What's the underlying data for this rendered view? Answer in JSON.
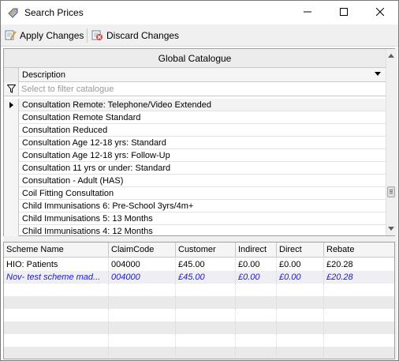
{
  "window": {
    "title": "Search Prices",
    "icons": {
      "app": "price-tag-icon",
      "minimize": "minimize-icon",
      "maximize": "maximize-icon",
      "close": "close-icon"
    }
  },
  "toolbar": {
    "apply_label": "Apply Changes",
    "apply_icon": "apply-changes-icon",
    "discard_label": "Discard Changes",
    "discard_icon": "discard-changes-icon"
  },
  "catalogue": {
    "title": "Global Catalogue",
    "column_header": "Description",
    "filter_placeholder": "Select to filter catalogue",
    "filter_value": "",
    "filter_icon": "filter-icon",
    "rows": [
      "Consultation Remote: Telephone/Video Extended",
      "Consultation Remote Standard",
      "Consultation Reduced",
      "Consultation Age 12-18 yrs: Standard",
      "Consultation Age 12-18 yrs: Follow-Up",
      "Consultation 11 yrs or under: Standard",
      "Consultation - Adult (HAS)",
      "Coil Fitting Consultation",
      "Child Immunisations 6: Pre-School 3yrs/4m+",
      "Child Immunisations 5: 13 Months",
      "Child Immunisations 4: 12 Months"
    ],
    "selected_index": 0
  },
  "pricing": {
    "columns": [
      "Scheme Name",
      "ClaimCode",
      "Customer",
      "Indirect",
      "Direct",
      "Rebate"
    ],
    "rows": [
      [
        "HIO: Patients",
        "004000",
        "£45.00",
        "£0.00",
        "£0.00",
        "£20.28"
      ],
      [
        "Nov- test scheme mad...",
        "004000",
        "£45.00",
        "£0.00",
        "£0.00",
        "£20.28"
      ]
    ],
    "scheme_row_color": "#1a1ad0"
  }
}
